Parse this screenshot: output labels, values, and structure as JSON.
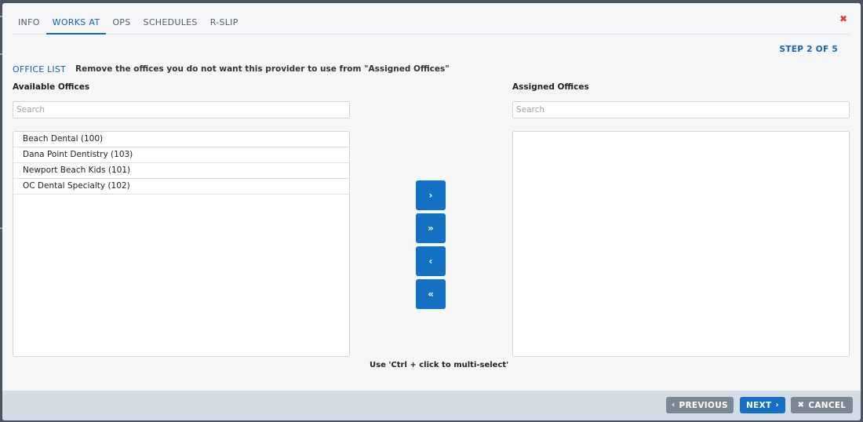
{
  "tabs": [
    {
      "label": "INFO",
      "active": false
    },
    {
      "label": "WORKS AT",
      "active": true
    },
    {
      "label": "OPS",
      "active": false
    },
    {
      "label": "SCHEDULES",
      "active": false
    },
    {
      "label": "R-SLIP",
      "active": false
    }
  ],
  "close_icon": "✖",
  "step": "STEP 2 OF 5",
  "section": {
    "title": "OFFICE LIST",
    "description": "Remove the offices you do not want this provider to use from \"Assigned Offices\""
  },
  "available": {
    "label": "Available Offices",
    "search_placeholder": "Search",
    "items": [
      "Beach Dental (100)",
      "Dana Point Dentistry (103)",
      "Newport Beach Kids (101)",
      "OC Dental Specialty (102)"
    ]
  },
  "assigned": {
    "label": "Assigned Offices",
    "search_placeholder": "Search",
    "items": []
  },
  "move_buttons": {
    "move_selected_right": "›",
    "move_all_right": "»",
    "move_selected_left": "‹",
    "move_all_left": "«"
  },
  "hint": "Use 'Ctrl + click to multi-select'",
  "footer": {
    "previous_label": "PREVIOUS",
    "previous_icon": "‹",
    "next_label": "NEXT",
    "next_icon": "›",
    "cancel_label": "CANCEL",
    "cancel_icon": "✖"
  },
  "colors": {
    "accent": "#1370c2",
    "danger": "#e53935",
    "gray_button": "#7b8894"
  }
}
